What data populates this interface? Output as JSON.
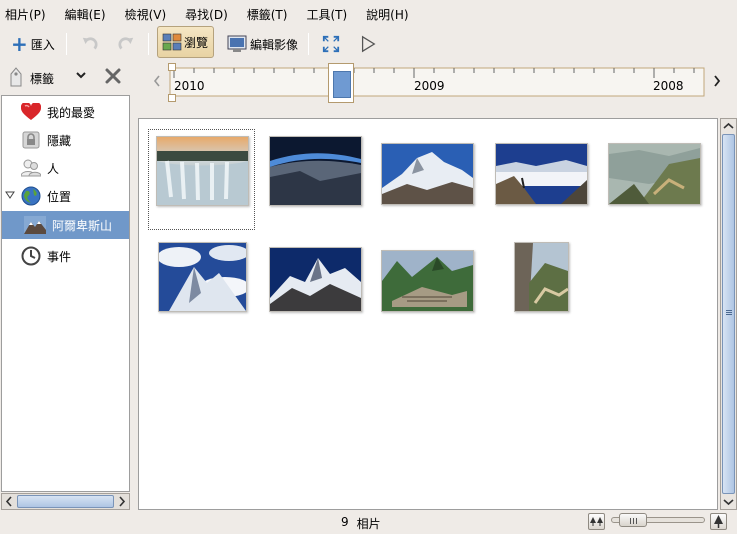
{
  "menubar": {
    "items": [
      {
        "label": "相片(P)"
      },
      {
        "label": "編輯(E)"
      },
      {
        "label": "檢視(V)"
      },
      {
        "label": "尋找(D)"
      },
      {
        "label": "標籤(T)"
      },
      {
        "label": "工具(T)"
      },
      {
        "label": "說明(H)"
      }
    ]
  },
  "toolbar": {
    "import_label": "匯入",
    "browse_label": "瀏覽",
    "edit_label": "編輯影像"
  },
  "tags_bar": {
    "label": "標籤"
  },
  "sidebar": {
    "items": [
      {
        "label": "我的最愛",
        "icon": "heart-icon"
      },
      {
        "label": "隱藏",
        "icon": "lock-icon"
      },
      {
        "label": "人",
        "icon": "people-icon"
      },
      {
        "label": "位置",
        "icon": "globe-icon"
      },
      {
        "label": "阿爾卑斯山",
        "icon": "mountain-thumb-icon"
      },
      {
        "label": "事件",
        "icon": "clock-icon"
      }
    ]
  },
  "timeline": {
    "years": [
      "2010",
      "2009",
      "2008"
    ]
  },
  "photos": {
    "count": 9
  },
  "status": {
    "count": "9",
    "unit": "相片"
  },
  "colors": {
    "selected": "#7098c9",
    "active_button": "#e8d3a3"
  }
}
